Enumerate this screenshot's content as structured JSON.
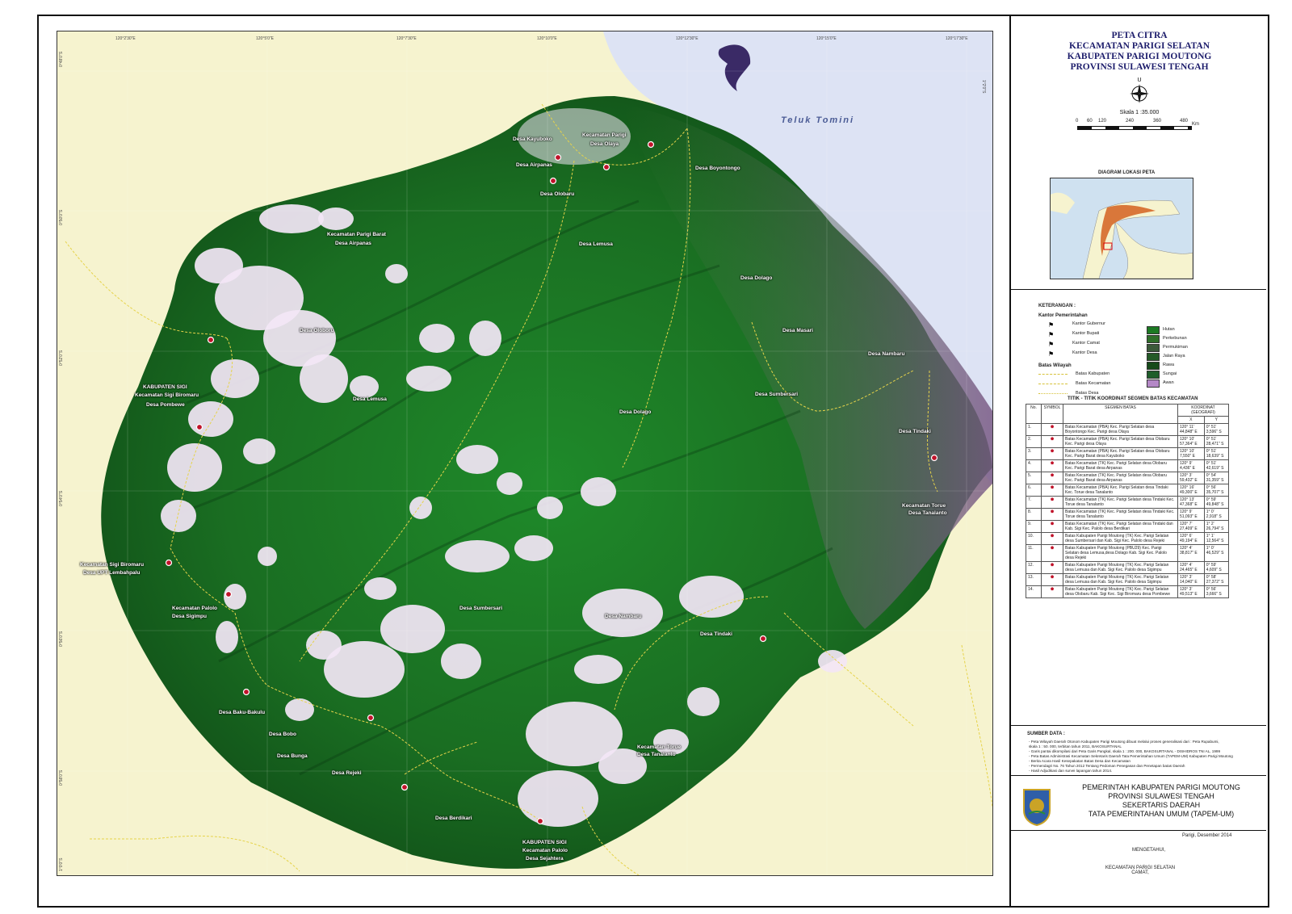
{
  "map": {
    "sea_label": "Teluk   Tomini",
    "ticks_top": [
      "120°2'30\"E",
      "120°5'0\"E",
      "120°7'30\"E",
      "120°10'0\"E",
      "120°12'30\"E",
      "120°15'0\"E",
      "120°17'30\"E"
    ],
    "ticks_left": [
      "0°48'0\"S",
      "0°50'0\"S",
      "0°52'0\"S",
      "0°54'0\"S",
      "0°56'0\"S",
      "0°58'0\"S",
      "1°0'0\"S",
      "1°2'0\"S"
    ],
    "places": [
      "Desa Kayuboko",
      "Kecamatan Parigi",
      "Desa Olaya",
      "Desa Airpanas",
      "Desa Olobaru",
      "Desa Boyontongo",
      "Kecamatan Parigi Barat",
      "Desa Airpanas",
      "Desa Lemusa",
      "Desa Dolago",
      "Desa Masari",
      "Desa Nambaru",
      "Desa Oloboru",
      "KABUPATEN SIGI",
      "Kecamatan Sigi Biromaru",
      "Desa Pombewe",
      "Desa Lemusa",
      "Desa Sumbersari",
      "Desa Dolago",
      "Desa Tindaki",
      "Kecamatan Torue",
      "Desa Tanalanto",
      "Kecamatan Sigi Biromaru",
      "Desa UPT Lembahpalu",
      "Kecamatan Palolo",
      "Desa Sigimpu",
      "Desa Sumbersari",
      "Desa Nambaru",
      "Desa Tindaki",
      "Desa Baku-Bakulu",
      "Desa Bobo",
      "Desa Bunga",
      "Desa Rejeki",
      "Kecamatan Torue",
      "Desa Tanalanto",
      "Desa Berdikari",
      "KABUPATEN SIGI",
      "Kecamatan Palolo",
      "Desa Sejahtera"
    ]
  },
  "panel": {
    "title_lines": [
      "PETA CITRA",
      "KECAMATAN PARIGI  SELATAN",
      "KABUPATEN PARIGI MOUTONG",
      "PROVINSI SULAWESI TENGAH"
    ],
    "north": "U",
    "scale_text": "Skala   1 :35.000",
    "scale_ticks": [
      "0",
      "60",
      "120",
      "240",
      "360",
      "480"
    ],
    "scale_unit": "Km",
    "diagram_title": "DIAGRAM LOKASI PETA",
    "legend_title": "KETERANGAN :",
    "legend_gov": "Kantor Pemerintahan",
    "legend_gov_items": [
      "Kantor Gubernur",
      "Kantor Bupati",
      "Kantor Camat",
      "Kantor Desa"
    ],
    "legend_bound": "Batas Wilayah",
    "legend_bound_items": [
      "Batas Kabupaten",
      "Batas Kecamatan",
      "Batas Desa"
    ],
    "legend_land": [
      "Hutan",
      "Perkebunan",
      "Permukiman",
      "Jalan Raya",
      "Rawa",
      "Sungai",
      "Awan"
    ],
    "coord_title": "TITIK - TITIK KOORDINAT SEGMEN BATAS KECAMATAN",
    "coord_headers": [
      "No.",
      "SYMBOL",
      "SEGMEN BATAS",
      "KOORDINAT  (GEOGRAFI)",
      "X",
      "Y"
    ],
    "coord_rows": [
      {
        "no": "1.",
        "seg": "Batas Kecamatan (PBA) Kec. Parigi Selatan desa Boyontongo Kec. Parigi desa Olaya",
        "x": "120° 11' 44,848\" E",
        "y": "0° 51' 3,596\" S"
      },
      {
        "no": "2.",
        "seg": "Batas Kecamatan (PBA) Kec. Parigi Selatan desa Olobaru Kec. Parigi desa Olaya",
        "x": "120° 10' 57,364\" E",
        "y": "0° 51' 28,471\" S"
      },
      {
        "no": "3.",
        "seg": "Batas Kecamatan (PBA) Kec. Parigi Selatan desa Olobaru Kec. Parigi Barat desa Kayuboko",
        "x": "120° 10' 7,550\" E",
        "y": "0° 51' 18,639\" S"
      },
      {
        "no": "4.",
        "seg": "Batas Kecamatan (TK) Kec. Parigi Selatan desa Olobaru Kec. Parigi Barat desa Airpanas",
        "x": "120° 9' 4,436\" E",
        "y": "0° 51' 42,619\" S"
      },
      {
        "no": "5.",
        "seg": "Batas Kecamatan (TK) Kec. Parigi Selatan desa Olobaru Kec. Parigi Barat desa Airpanas",
        "x": "120° 3' 59,432\" E",
        "y": "0° 54' 31,359\" S"
      },
      {
        "no": "6.",
        "seg": "Batas Kecamatan (PBA) Kec. Parigi Selatan desa Tindaki Kec. Torue  desa Tanalanto",
        "x": "120° 16' 49,300\" E",
        "y": "0° 56' 35,707\" S"
      },
      {
        "no": "7.",
        "seg": "Batas Kecamatan (TK) Kec. Parigi Selatan desa Tindaki Kec. Torue  desa Tanalanto",
        "x": "120° 13' 47,368\" E",
        "y": "0° 59' 49,848\" S"
      },
      {
        "no": "8.",
        "seg": "Batas Kecamatan (TK) Kec. Parigi Selatan desa Tindaki Kec. Torue  desa Tanalanto",
        "x": "120° 9' 51,093\" E",
        "y": "1° 0' 2,918\" S"
      },
      {
        "no": "9.",
        "seg": "Batas Kecamatan (TK) Kec. Parigi Selatan desa Tindaki dan Kab. Sigi Kec. Palolo desa Berdikari",
        "x": "120° 7' 27,409\" E",
        "y": "1° 2' 26,794\" S"
      },
      {
        "no": "10.",
        "seg": "Batas Kabupaten Parigi Moutong (TK) Kec. Parigi Selatan desa Sumbersari dan Kab. Sigi Kec. Palolo desa Rejeki",
        "x": "120° 6' 49,194\" E",
        "y": "1° 1' 12,564\" S"
      },
      {
        "no": "11.",
        "seg": "Batas Kabupaten Parigi Moutong (PBU29) Kec. Parigi Selatan desa Lemusa,desa Dolago Kab. Sigi Kec. Palolo desa Rejeki",
        "x": "120° 4' 38,817\" E",
        "y": "1° 0' 46,529\" S"
      },
      {
        "no": "12.",
        "seg": "Batas Kabupaten Parigi Moutong (TK) Kec. Parigi Selatan desa Lemusa dan Kab. Sigi Kec. Palolo desa Sigimpu",
        "x": "120° 4' 24,465\" E",
        "y": "0° 59' 4,609\" S"
      },
      {
        "no": "13.",
        "seg": "Batas Kabupaten Parigi Moutong (TK) Kec. Parigi Selatan desa Lemusa dan Kab. Sigi Kec. Palolo desa Sigimpu",
        "x": "120° 3' 14,040\" E",
        "y": "0° 58' 27,372\" S"
      },
      {
        "no": "14.",
        "seg": "Batas Kabupaten Parigi Moutong (TK) Kec. Parigi Selatan desa Olobaru Kab. Sigi Kec. Sigi Biromaru desa Pombewe",
        "x": "120° 3' 49,513\" E",
        "y": "0° 56' 3,666\" S"
      }
    ],
    "source_title": "SUMBER DATA :",
    "source_lines": [
      "- Peta Wilayah Daerah Otonom Kabupaten Parigi Moutong dibuat melalui proses generalisasi dari : Peta Rupabumi,",
      "  skala  1 : 50. 000, terbitan tahun 2011, BAKOSURTANAL",
      "- Garis pantai dikompilasi  dari Peta Garis Pangkal, skala  1 : 200. 000, BAKOSURTANAL - DISHIDROS TNI AL, 1999",
      "- Peta Batas Administrasi Kecamatan  Sekretaris Daerah Tata Pemerintahan Umum (TAPEM-UM) Kabupaten Parigi Moutong",
      "- Berita Acara Hasil Kesepakatan Batas Desa dan Kecamatan",
      "- Permendagri No. 76 Tahun 2012 Tentang Pedoman Penegasan dan Penetapan batas Daerah",
      "- Hasil Adjudikasi dan survei lapangan tahun 2014."
    ],
    "gov_lines": [
      "PEMERINTAH  KABUPATEN PARIGI MOUTONG",
      "PROVINSI SULAWESI TENGAH",
      "SEKERTARIS DAERAH",
      "TATA PEMERINTAHAN UMUM (TAPEM-UM)"
    ],
    "date": "Parigi,     Desember  2014",
    "mengetahui": "MENGETAHUI,",
    "camat_lines": [
      "KECAMATAN  PARIGI SELATAN",
      "CAMAT,"
    ]
  }
}
